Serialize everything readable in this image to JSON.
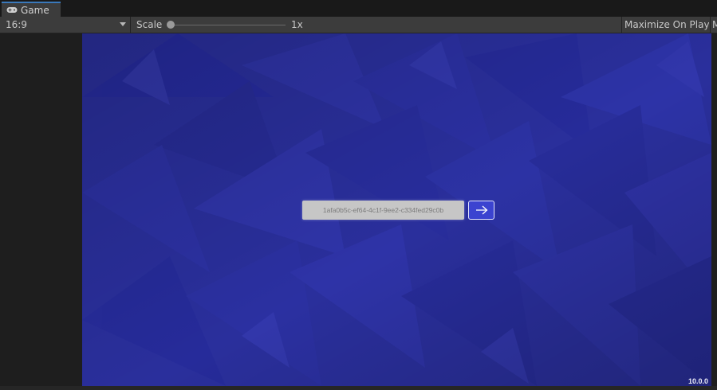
{
  "tab": {
    "icon": "gamepad-icon",
    "label": "Game"
  },
  "toolbar": {
    "aspect_value": "16:9",
    "scale_label": "Scale",
    "scale_value": "1x",
    "scale_level": 0.0,
    "maximize_label": "Maximize On Play",
    "next_label": "M"
  },
  "game": {
    "background_color": "#2a2f9c",
    "input_value": "1afa0b5c-ef64-4c1f-9ee2-c334fed29c0b",
    "submit_icon": "arrow-right-icon",
    "version": "10.0.0"
  }
}
